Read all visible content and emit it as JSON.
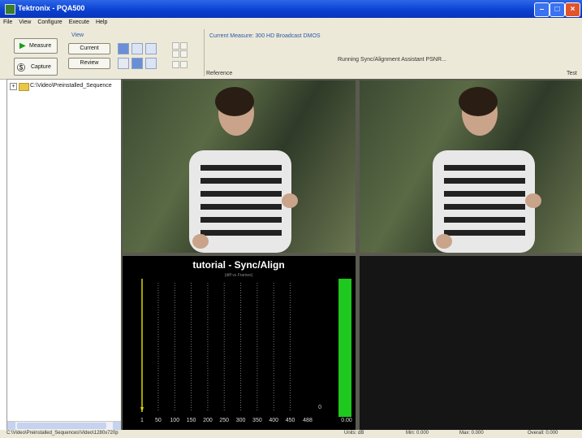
{
  "window": {
    "title": "Tektronix - PQA500"
  },
  "menu": [
    "File",
    "View",
    "Configure",
    "Execute",
    "Help"
  ],
  "toolbar": {
    "measure_label": "Measure",
    "capture_label": "Capture",
    "view_label": "View",
    "current_label": "Current",
    "review_label": "Review",
    "current_measure": "Current Measure: 300 HD Broadcast DMOS",
    "running_status": "Running Sync/Alignment Assistant PSNR...",
    "reference_label": "Reference",
    "test_label": "Test"
  },
  "sidebar": {
    "tree_item": "C:\\Video\\Preinstalled_Sequence"
  },
  "chart_data": {
    "type": "bar",
    "title": "tutorial - Sync/Align",
    "subtitle": "(diff vs Frames)",
    "x_ticks": [
      1,
      50,
      100,
      150,
      200,
      250,
      300,
      350,
      400,
      450
    ],
    "x_end_label": "488",
    "y_zero_label": "0",
    "value_label": "0.00",
    "green_bar_value": 1.0,
    "ylim": [
      0,
      1
    ],
    "colors": {
      "bar": "#1ec81e",
      "marker": "#d8d800",
      "grid": "#777777"
    }
  },
  "statusbar": {
    "path": "C:\\Video\\Preinstalled_Sequences\\Video\\1280x720p",
    "units": "Units: dB",
    "min": "Min: 0.000",
    "max": "Max: 0.000",
    "overall": "Overall: 0.000"
  }
}
